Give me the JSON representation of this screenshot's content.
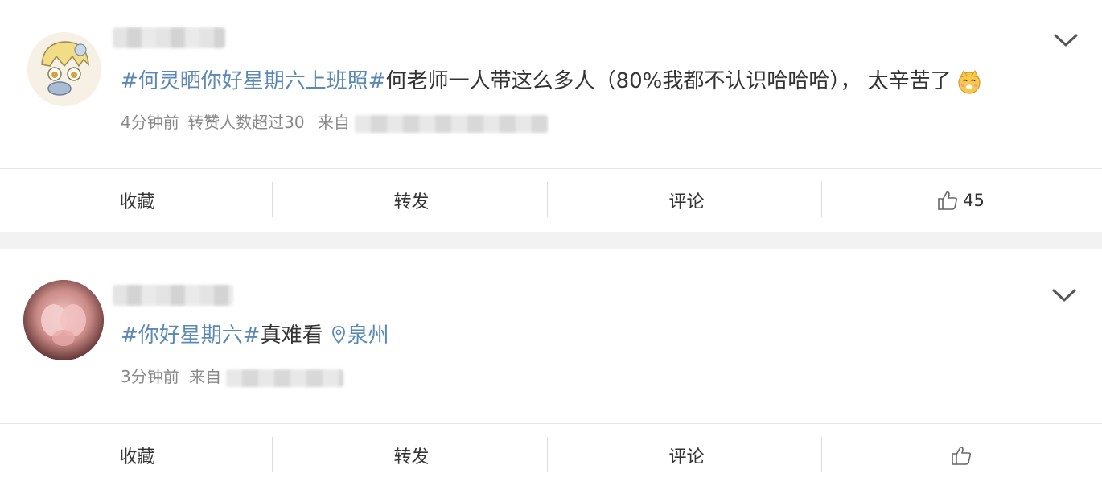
{
  "posts": [
    {
      "topic": "#何灵晒你好星期六上班照#",
      "text": "何老师一人带这么多人（80%我都不认识哈哈哈）， 太辛苦了",
      "time": "4分钟前",
      "reposts_note": "转赞人数超过30",
      "source_label": "来自",
      "actions": {
        "favorite": "收藏",
        "repost": "转发",
        "comment": "评论",
        "like_count": "45"
      }
    },
    {
      "topic": "#你好星期六#",
      "text": "真难看",
      "location": "泉州",
      "time": "3分钟前",
      "source_label": "来自",
      "actions": {
        "favorite": "收藏",
        "repost": "转发",
        "comment": "评论"
      }
    }
  ],
  "icons": {
    "expand": "chevron-down-icon",
    "like": "thumbs-up-icon",
    "location": "location-pin-icon",
    "emoji": "cat-emoji-icon"
  },
  "colors": {
    "topic": "#5b89b5",
    "meta": "#888888",
    "text": "#333333",
    "background": "#f2f2f2"
  }
}
